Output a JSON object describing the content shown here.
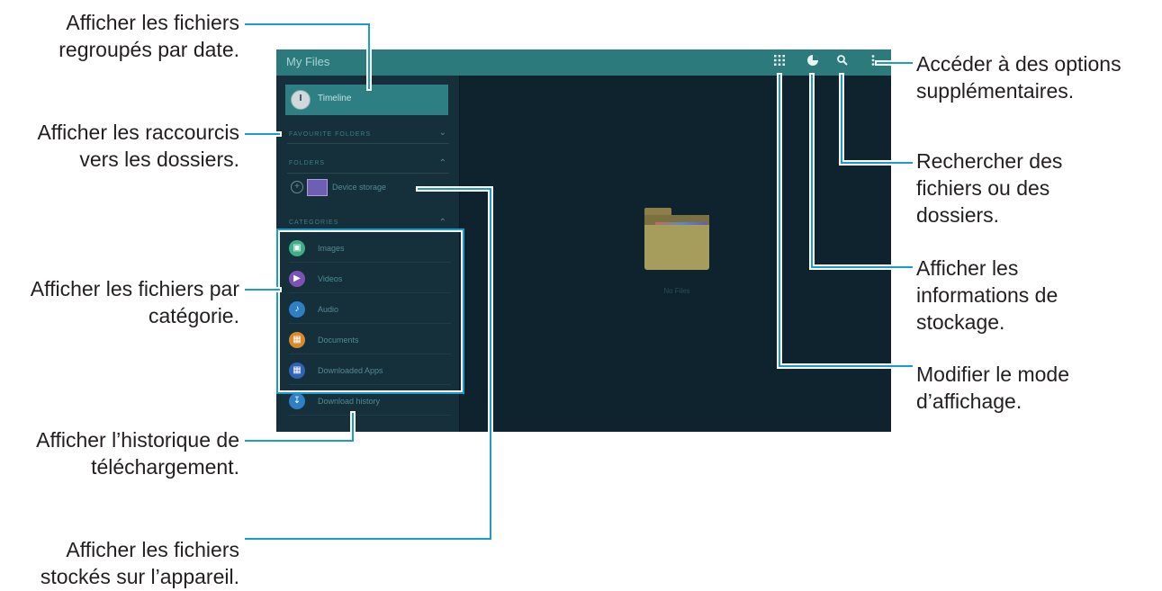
{
  "callouts": {
    "timeline": [
      "Afficher les fichiers",
      "regroupés par date."
    ],
    "shortcuts": [
      "Afficher les raccourcis",
      "vers les dossiers."
    ],
    "categories": [
      "Afficher les fichiers par",
      "catégorie."
    ],
    "download_history": [
      "Afficher l’historique de",
      "téléchargement."
    ],
    "device_storage": [
      "Afficher les fichiers",
      "stockés sur l’appareil."
    ],
    "more_options": [
      "Accéder à des options",
      "supplémentaires."
    ],
    "search": [
      "Rechercher des",
      "fichiers ou des",
      "dossiers."
    ],
    "storage_info": [
      "Afficher les",
      "informations de",
      "stockage."
    ],
    "view_mode": [
      "Modifier le mode",
      "d’affichage."
    ]
  },
  "app": {
    "title": "My Files",
    "sidebar": {
      "timeline": "Timeline",
      "favorite_folders": "FAVOURITE FOLDERS",
      "folders": "FOLDERS",
      "device_storage": "Device storage",
      "categories_header": "CATEGORIES",
      "categories": [
        {
          "label": "Images",
          "icon": "image-icon",
          "color": "#3fae86"
        },
        {
          "label": "Videos",
          "icon": "video-icon",
          "color": "#7b53b6"
        },
        {
          "label": "Audio",
          "icon": "music-note-icon",
          "color": "#2f7fc4"
        },
        {
          "label": "Documents",
          "icon": "document-icon",
          "color": "#d98a2d"
        },
        {
          "label": "Downloaded Apps",
          "icon": "apps-icon",
          "color": "#3063b5"
        }
      ],
      "download_history": "Download history"
    },
    "main": {
      "empty_label": "No Files"
    },
    "colors": {
      "appbar": "#2c7a7c",
      "sidebar": "#15303b",
      "main": "#0f232e",
      "callout_line": "#1b9cc9"
    }
  }
}
